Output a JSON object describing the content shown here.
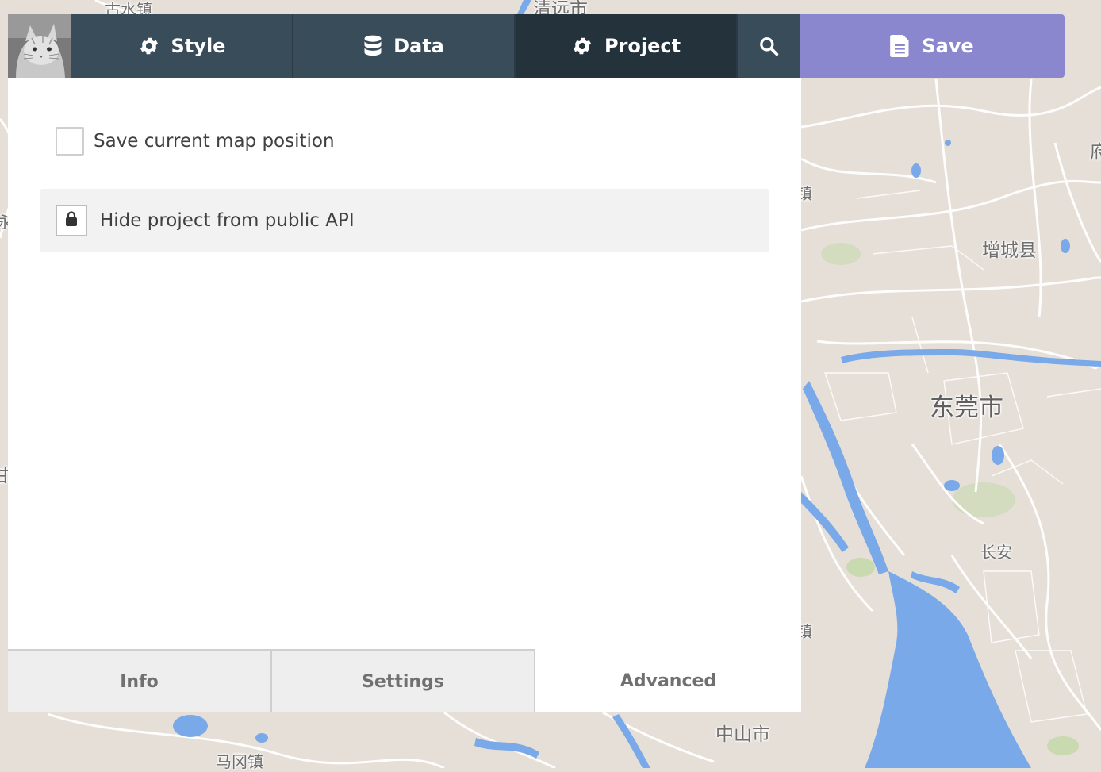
{
  "toolbar": {
    "tabs": {
      "style": "Style",
      "data": "Data",
      "project": "Project",
      "save": "Save"
    },
    "active_tab": "Project",
    "icons": {
      "style": "gear-icon",
      "data": "database-icon",
      "project": "gear-icon",
      "search": "search-icon",
      "save": "document-icon"
    }
  },
  "panel": {
    "save_position_label": "Save current map position",
    "save_position_checked": false,
    "hide_api_label": "Hide project from public API",
    "hide_api_icon": "lock-icon"
  },
  "bottom_tabs": {
    "info": "Info",
    "settings": "Settings",
    "advanced": "Advanced",
    "active": "Advanced"
  },
  "map": {
    "labels": {
      "gushui": "古水镇",
      "qingyuan": "清远市",
      "zengcheng": "增城县",
      "dongguan": "东莞市",
      "changan": "长安",
      "zhongshan": "中山市",
      "magang": "马冈镇",
      "edge_fu": "府",
      "edge_yong": "永",
      "edge_gan": "甘",
      "edge_zhen1": "镇",
      "edge_zhen2": "镇"
    }
  },
  "colors": {
    "toolbar_bg": "#394c5a",
    "toolbar_active": "#24323b",
    "save_bg": "#8b87cf",
    "water": "#79a9e8",
    "land": "#e6dfd8",
    "park": "#c9d9b0"
  }
}
